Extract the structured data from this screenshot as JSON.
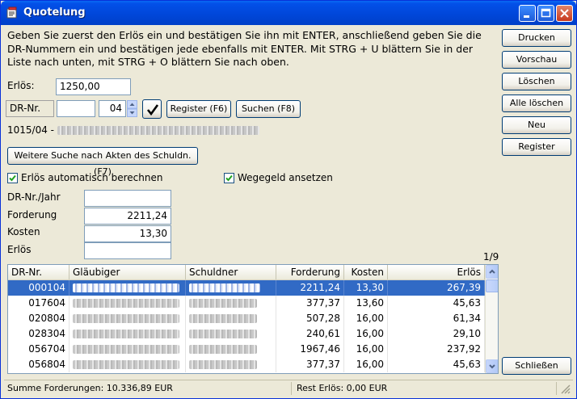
{
  "window": {
    "title": "Quotelung"
  },
  "instructions": "Geben Sie zuerst den Erlös ein und bestätigen Sie ihn mit ENTER, anschließend geben Sie die DR-Nummern ein und bestätigen jede ebenfalls mit ENTER. Mit STRG + U blättern Sie in der Liste nach unten, mit STRG + O blättern Sie nach oben.",
  "form": {
    "erloes_label": "Erlös:",
    "erloes_value": "1250,00",
    "dr_nr_label": "DR-Nr.",
    "dr_nr_value": "",
    "dr_year_value": "04",
    "register_button": "Register (F6)",
    "search_button": "Suchen (F8)",
    "case_number": "1015/04 -",
    "further_search_button": "Weitere Suche nach Akten des Schuldn. (F7)",
    "auto_calc_label": "Erlös automatisch berechnen",
    "auto_calc_checked": true,
    "wegegeld_label": "Wegegeld ansetzen",
    "wegegeld_checked": true,
    "dr_nr_jahr_label": "DR-Nr./Jahr",
    "dr_nr_jahr_value": "",
    "forderung_label": "Forderung",
    "forderung_value": "2211,24",
    "kosten_label": "Kosten",
    "kosten_value": "13,30",
    "erloes2_label": "Erlös",
    "erloes2_value": ""
  },
  "side_buttons": {
    "drucken": "Drucken",
    "vorschau": "Vorschau",
    "loeschen": "Löschen",
    "alle_loeschen": "Alle löschen",
    "neu": "Neu",
    "register": "Register",
    "schliessen": "Schließen"
  },
  "list": {
    "page_indicator": "1/9",
    "columns": [
      "DR-Nr.",
      "Gläubiger",
      "Schuldner",
      "Forderung",
      "Kosten",
      "Erlös"
    ],
    "rows": [
      {
        "dr_nr": "000104",
        "forderung": "2211,24",
        "kosten": "13,30",
        "erloes": "267,39",
        "selected": true
      },
      {
        "dr_nr": "017604",
        "forderung": "377,37",
        "kosten": "13,60",
        "erloes": "45,63"
      },
      {
        "dr_nr": "020804",
        "forderung": "507,28",
        "kosten": "16,00",
        "erloes": "61,34"
      },
      {
        "dr_nr": "028304",
        "forderung": "240,61",
        "kosten": "16,00",
        "erloes": "29,10"
      },
      {
        "dr_nr": "056704",
        "forderung": "1967,46",
        "kosten": "16,00",
        "erloes": "237,92"
      },
      {
        "dr_nr": "056804",
        "forderung": "377,37",
        "kosten": "16,00",
        "erloes": "45,63"
      }
    ]
  },
  "status": {
    "summe": "Summe Forderungen: 10.336,89 EUR",
    "rest": "Rest Erlös: 0,00 EUR"
  },
  "colors": {
    "titlebar": "#0046d8",
    "selection": "#316ac5",
    "face": "#ece9d8"
  }
}
